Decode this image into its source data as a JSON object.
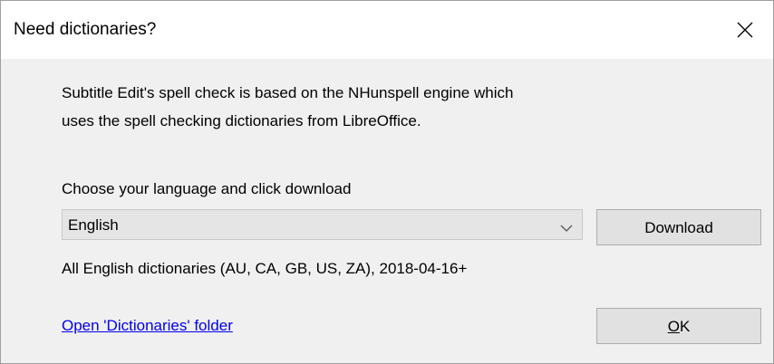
{
  "window": {
    "title": "Need dictionaries?",
    "close_icon": "close-icon"
  },
  "description": {
    "line1": "Subtitle Edit's spell check is based on the NHunspell engine which",
    "line2": "uses the spell checking dictionaries from LibreOffice."
  },
  "language": {
    "label": "Choose your language and click download",
    "selected": "English",
    "dropdown_icon": "chevron-down-icon",
    "info": "All English dictionaries (AU, CA, GB, US, ZA), 2018-04-16+"
  },
  "buttons": {
    "download": "Download",
    "ok_accel": "O",
    "ok_rest": "K"
  },
  "link": {
    "open_folder": "Open 'Dictionaries' folder"
  },
  "colors": {
    "window_bg": "#f0f0f0",
    "titlebar_bg": "#ffffff",
    "button_bg": "#e1e1e1",
    "combo_bg": "#e5e5e5",
    "link": "#0000ee"
  }
}
